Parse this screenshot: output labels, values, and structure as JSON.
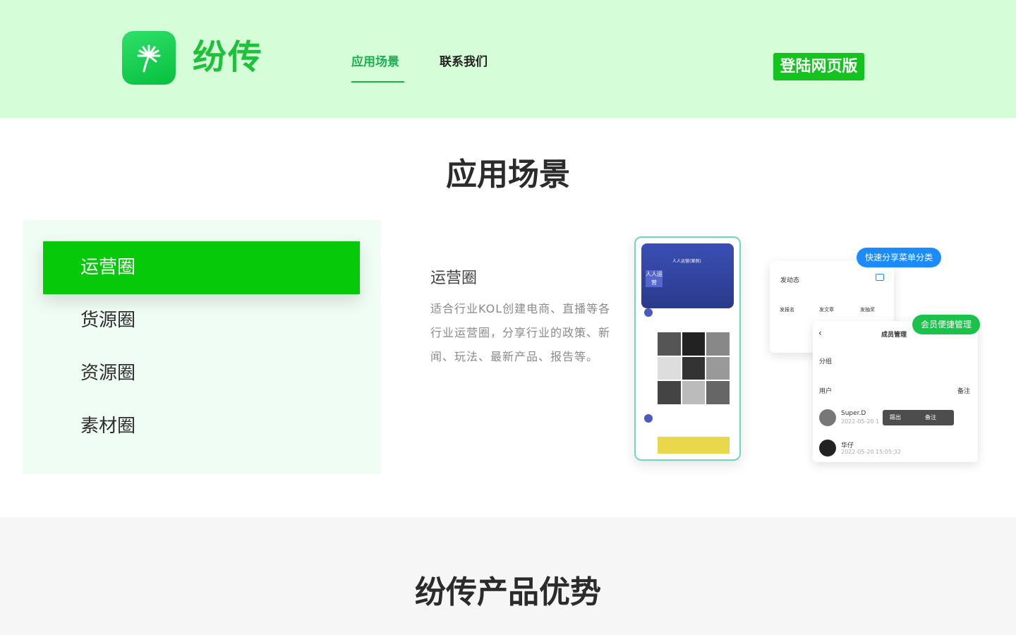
{
  "header": {
    "brand": "纷传",
    "nav": {
      "scenes": "应用场景",
      "contact": "联系我们"
    },
    "login_label": "登陆网页版"
  },
  "scenes": {
    "title": "应用场景",
    "tabs": [
      "运营圈",
      "货源圈",
      "资源圈",
      "素材圈"
    ],
    "active_tab": 0,
    "detail_title": "运营圈",
    "detail_text": "适合行业KOL创建电商、直播等各行业运营圈，分享行业的政策、新闻、玩法、最新产品、报告等。"
  },
  "illustration": {
    "bubble_share": "快速分享菜单分类",
    "bubble_member": "会员便捷管理",
    "post_label": "发动态",
    "actions": [
      "发报名",
      "发文章",
      "发抽奖"
    ],
    "member_title": "成员管理",
    "group_label": "分组",
    "user_label": "用户",
    "remark_label": "备注",
    "kick_label": "踢出",
    "note_label": "备注",
    "users": [
      {
        "name": "Super.D",
        "time": "2022-05-20 1"
      },
      {
        "name": "华仔",
        "time": "2022-05-20 15:05:32"
      }
    ],
    "phone_title": "人人运营(案例)",
    "phone_avatar": "人人运营",
    "colors": {
      "green": "#06c90a",
      "blue": "#1a8cff",
      "bubble_green": "#19c34a"
    }
  },
  "advantages": {
    "title": "纷传产品优势"
  }
}
